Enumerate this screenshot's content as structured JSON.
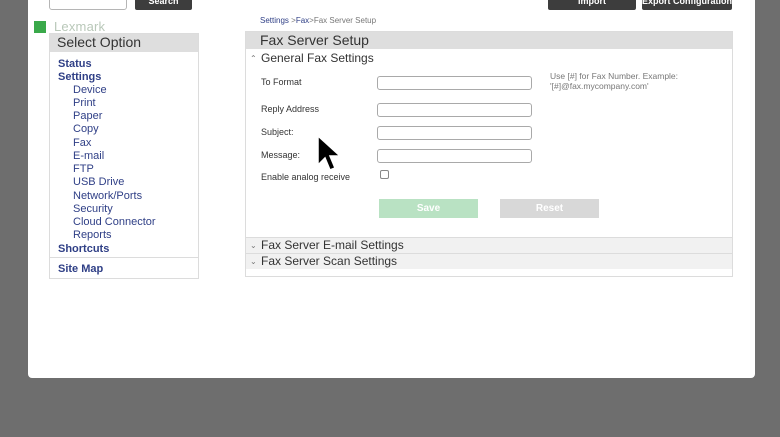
{
  "header": {
    "search_button": "Search",
    "import_button": "Import Configuration",
    "export_button": "Export Configuration"
  },
  "logo": {
    "text": "Lexmark"
  },
  "sidebar": {
    "title": "Select Option",
    "items": [
      {
        "label": "Status",
        "level": "top"
      },
      {
        "label": "Settings",
        "level": "top"
      },
      {
        "label": "Device",
        "level": "sub"
      },
      {
        "label": "Print",
        "level": "sub"
      },
      {
        "label": "Paper",
        "level": "sub"
      },
      {
        "label": "Copy",
        "level": "sub"
      },
      {
        "label": "Fax",
        "level": "sub"
      },
      {
        "label": "E-mail",
        "level": "sub"
      },
      {
        "label": "FTP",
        "level": "sub"
      },
      {
        "label": "USB Drive",
        "level": "sub"
      },
      {
        "label": "Network/Ports",
        "level": "sub"
      },
      {
        "label": "Security",
        "level": "sub"
      },
      {
        "label": "Cloud Connector",
        "level": "sub"
      },
      {
        "label": "Reports",
        "level": "sub"
      },
      {
        "label": "Shortcuts",
        "level": "top"
      }
    ],
    "site_map": "Site Map"
  },
  "breadcrumb": {
    "settings": "Settings",
    "fax": "Fax",
    "current": "Fax Server Setup",
    "sep": ">"
  },
  "content": {
    "title": "Fax Server Setup",
    "general_section": "General Fax Settings",
    "fields": {
      "to_format": "To Format",
      "reply_address": "Reply Address",
      "subject": "Subject:",
      "message": "Message:",
      "enable_analog": "Enable analog receive"
    },
    "hint": "Use [#] for Fax Number. Example: '[#]@fax.mycompany.com'",
    "save_button": "Save",
    "reset_button": "Reset",
    "email_section": "Fax Server E-mail Settings",
    "scan_section": "Fax Server Scan Settings"
  },
  "colors": {
    "link": "#2f3f86",
    "save_disabled": "#b9e2c3",
    "reset_disabled": "#d8d8d8",
    "logo_green": "#3aa94a"
  }
}
